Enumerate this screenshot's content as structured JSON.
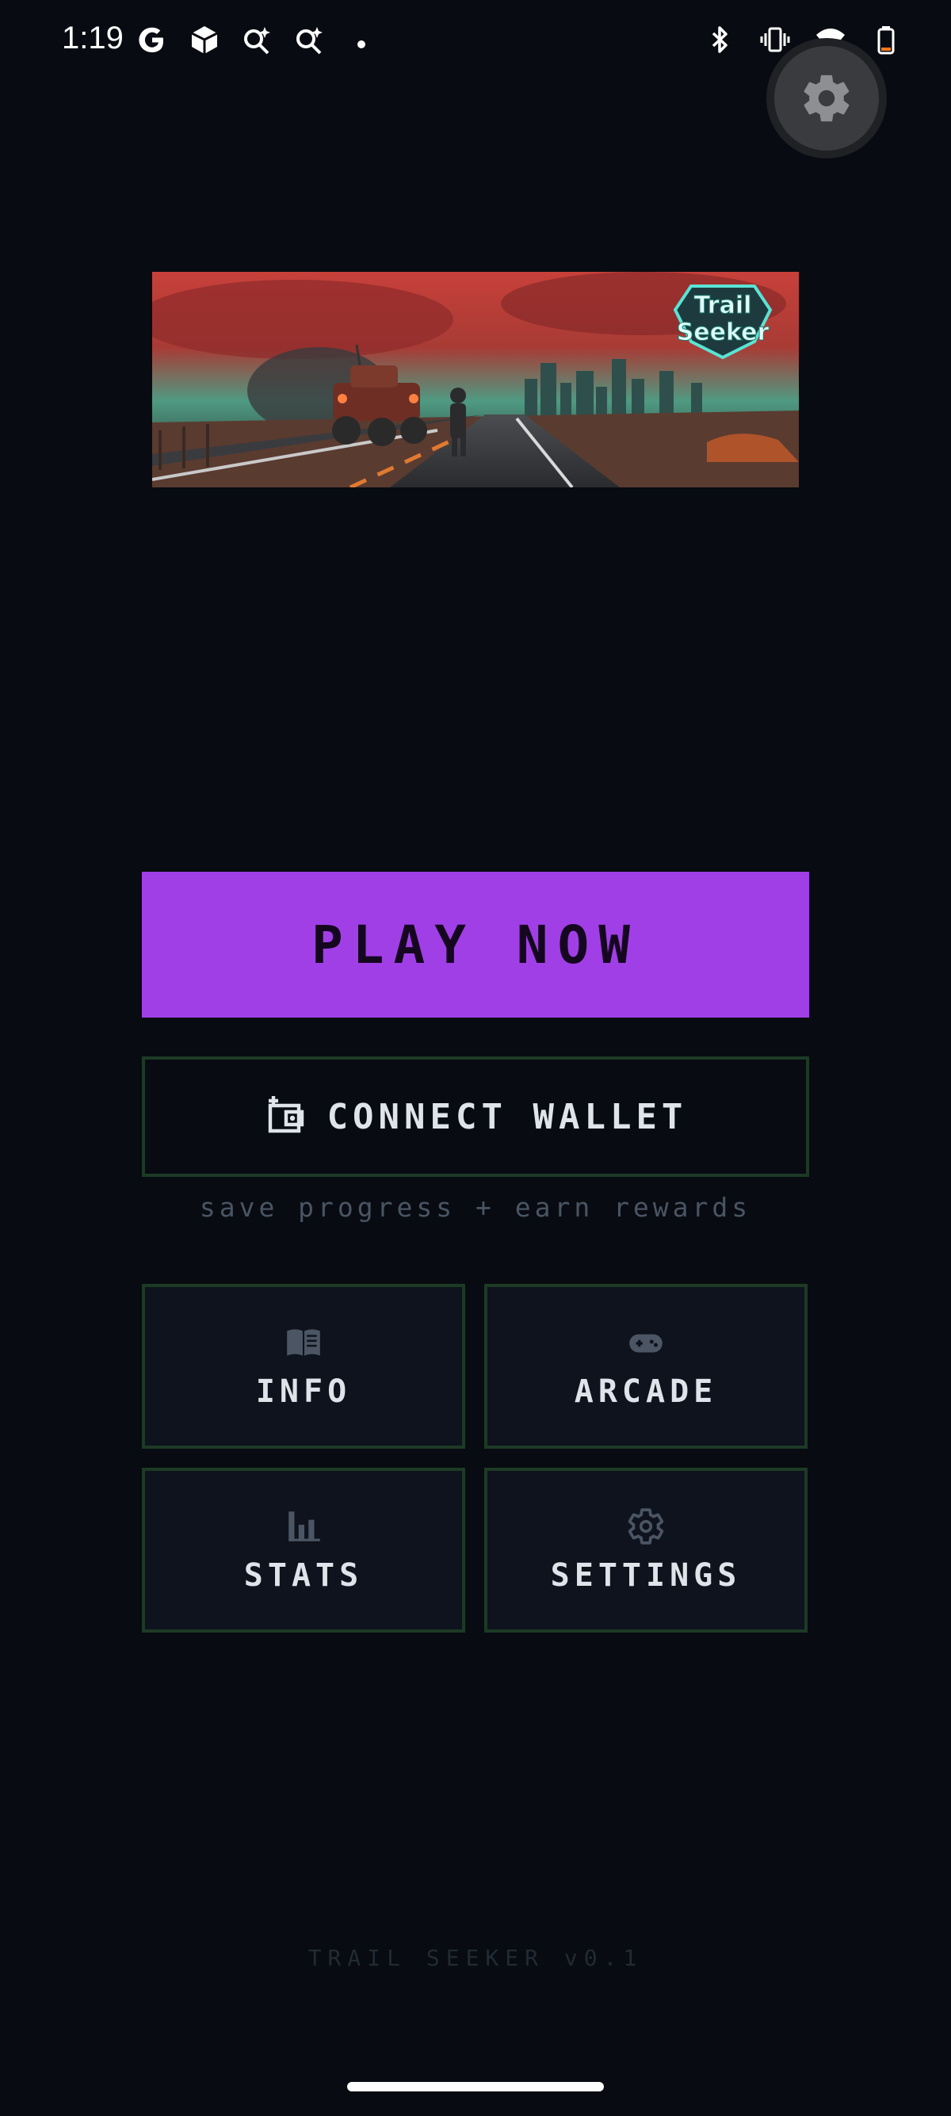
{
  "status_bar": {
    "time": "1:19",
    "left_icons": [
      "google-icon",
      "cube-icon",
      "sparkle-search-icon",
      "sparkle-search-icon",
      "dot-icon"
    ],
    "right_icons": [
      "bluetooth-icon",
      "vibrate-icon",
      "wifi-icon",
      "battery-icon"
    ]
  },
  "settings_fab": {
    "icon": "gear-icon"
  },
  "banner": {
    "logo_line1": "Trail",
    "logo_line2": "Seeker"
  },
  "play_button": {
    "label": "PLAY NOW"
  },
  "wallet_button": {
    "label": "CONNECT WALLET",
    "icon": "wallet-icon"
  },
  "wallet_subtitle": "save progress + earn rewards",
  "tiles": [
    {
      "label": "INFO",
      "icon": "book-icon"
    },
    {
      "label": "ARCADE",
      "icon": "gamepad-icon"
    },
    {
      "label": "STATS",
      "icon": "bar-chart-icon"
    },
    {
      "label": "SETTINGS",
      "icon": "gear-icon"
    }
  ],
  "footer_version": "TRAIL SEEKER v0.1",
  "colors": {
    "background": "#080b12",
    "play_button": "#a13fe6",
    "tile_border": "#1d3a25",
    "tile_bg": "#0e131d"
  }
}
